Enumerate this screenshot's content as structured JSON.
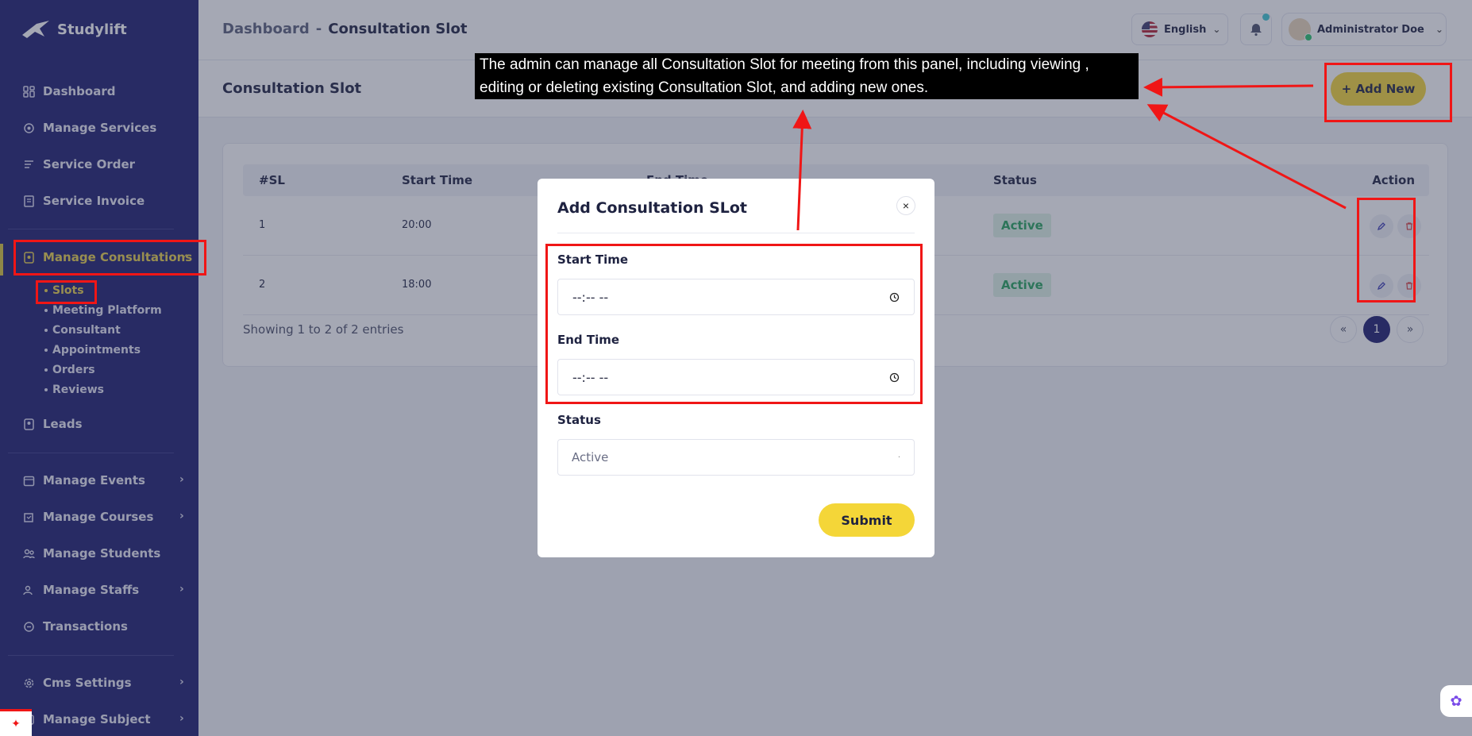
{
  "brand": {
    "name": "Studylift"
  },
  "header": {
    "breadcrumb_root": "Dashboard",
    "breadcrumb_sep": "-",
    "breadcrumb_current": "Consultation Slot",
    "language": "English",
    "user_name": "Administrator Doe"
  },
  "sidebar": {
    "items": [
      {
        "label": "Dashboard",
        "icon": "dashboard-icon"
      },
      {
        "label": "Manage Services",
        "icon": "services-icon"
      },
      {
        "label": "Service Order",
        "icon": "order-icon"
      },
      {
        "label": "Service Invoice",
        "icon": "invoice-icon"
      },
      {
        "label": "Manage Consultations",
        "icon": "consultation-icon"
      },
      {
        "label": "Leads",
        "icon": "leads-icon"
      },
      {
        "label": "Manage Events",
        "icon": "calendar-icon"
      },
      {
        "label": "Manage Courses",
        "icon": "courses-icon"
      },
      {
        "label": "Manage Students",
        "icon": "students-icon"
      },
      {
        "label": "Manage Staffs",
        "icon": "staff-icon"
      },
      {
        "label": "Transactions",
        "icon": "transactions-icon"
      },
      {
        "label": "Cms Settings",
        "icon": "settings-icon"
      },
      {
        "label": "Manage Subject",
        "icon": "subject-icon"
      }
    ],
    "sub_items": [
      "Slots",
      "Meeting Platform",
      "Consultant",
      "Appointments",
      "Orders",
      "Reviews"
    ]
  },
  "section": {
    "title": "Consultation Slot",
    "add_new_label": "+ Add New"
  },
  "table": {
    "columns": [
      "#SL",
      "Start Time",
      "End Time",
      "Status",
      "Action"
    ],
    "rows": [
      {
        "sl": "1",
        "start": "20:00",
        "status": "Active"
      },
      {
        "sl": "2",
        "start": "18:00",
        "status": "Active"
      }
    ],
    "showing": "Showing 1 to 2 of 2 entries",
    "pagination": {
      "prev": "«",
      "current": "1",
      "next": "»"
    }
  },
  "modal": {
    "title": "Add Consultation SLot",
    "close": "×",
    "start_label": "Start Time",
    "start_value": "--:-- --",
    "end_label": "End Time",
    "end_value": "--:-- --",
    "status_label": "Status",
    "status_value": "Active",
    "submit_label": "Submit"
  },
  "annotation": {
    "text": "The admin can manage all Consultation Slot for meeting from this panel, including viewing , editing or deleting existing Consultation Slot, and adding new ones."
  },
  "colors": {
    "sidebar": "#1c1c6e",
    "accent": "#f4d638",
    "active_text": "#e8d04a",
    "annotation": "#f01616",
    "status_active": "#26a35c"
  }
}
